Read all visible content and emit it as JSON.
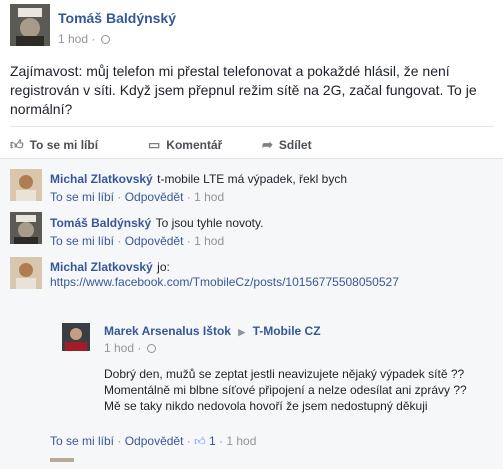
{
  "post": {
    "author": "Tomáš Baldýnský",
    "time": "1 hod",
    "text": "Zajímavost: můj telefon mi přestal telefonovat a pokaždé hlásil, že není registrován v síti. Když jsem přepnul režim sítě na 2G, začal fungovat. To je normální?"
  },
  "actions": {
    "like": "To se mi líbí",
    "comment": "Komentář",
    "share": "Sdílet"
  },
  "comments": [
    {
      "author": "Michal Zlatkovský",
      "text": "t-mobile LTE má výpadek, řekl bych",
      "like": "To se mi líbí",
      "reply": "Odpovědět",
      "time": "1 hod"
    },
    {
      "author": "Tomáš Baldýnský",
      "text": "To jsou tyhle novoty.",
      "like": "To se mi líbí",
      "reply": "Odpovědět",
      "time": "1 hod"
    },
    {
      "author": "Michal Zlatkovský",
      "text": "jo:",
      "link": "https://www.facebook.com/TmobileCz/posts/10156775508050527"
    }
  ],
  "embedded": {
    "author": "Marek Arsenalus Ištok",
    "arrow": "▶",
    "target": "T-Mobile CZ",
    "time": "1 hod",
    "lines": [
      "Dobrý den, mužů se zeptat jestli neavizujete nějaký výpadek sítě ??",
      "Momentálně mi blbne síťové připojení a nelze odesílat ani zprávy ??",
      "Mě se taky nikdo nedovola hovoří že jsem nedostupný děkuji"
    ]
  },
  "last_meta": {
    "like": "To se mi líbí",
    "reply": "Odpovědět",
    "likes_count": "1",
    "time": "1 hod"
  }
}
